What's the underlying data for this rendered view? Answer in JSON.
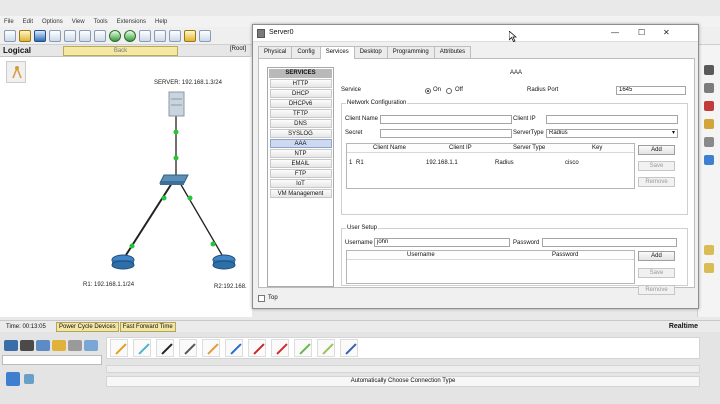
{
  "menu": [
    "File",
    "Edit",
    "Options",
    "View",
    "Tools",
    "Extensions",
    "Help"
  ],
  "logical": {
    "label": "Logical",
    "back_label": "Back",
    "root_label": "[Root]"
  },
  "topology": {
    "server_label": "SERVER: 192.168.1.3/24",
    "r1_label": "R1: 192.168.1.1/24",
    "r2_label": "R2:192.168."
  },
  "dialog": {
    "title": "Server0",
    "minimize": "—",
    "maximize": "☐",
    "close": "✕",
    "tabs": [
      "Physical",
      "Config",
      "Services",
      "Desktop",
      "Programming",
      "Attributes"
    ],
    "active_tab": "Services",
    "services_header": "SERVICES",
    "services": [
      "HTTP",
      "DHCP",
      "DHCPv6",
      "TFTP",
      "DNS",
      "SYSLOG",
      "AAA",
      "NTP",
      "EMAIL",
      "FTP",
      "IoT",
      "VM Management"
    ],
    "active_service": "AAA",
    "top_label": "Top"
  },
  "aaa": {
    "title": "AAA",
    "service_label": "Service",
    "on_label": "On",
    "off_label": "Off",
    "service_state": "On",
    "radius_port_label": "Radius Port",
    "radius_port_value": "1645",
    "network_config_title": "Network Configuration",
    "client_name_label": "Client Name",
    "client_name_value": "",
    "client_ip_label": "Client IP",
    "client_ip_value": "",
    "secret_label": "Secret",
    "secret_value": "",
    "server_type_label": "ServerType",
    "server_type_value": "Radius",
    "client_table": {
      "headers": [
        "Client Name",
        "Client IP",
        "Server Type",
        "Key"
      ],
      "rows": [
        {
          "index": "1",
          "name": "R1",
          "ip": "192.168.1.1",
          "type": "Radius",
          "key": "cisco"
        }
      ]
    },
    "add_label": "Add",
    "save_label": "Save",
    "remove_label": "Remove",
    "user_setup_title": "User Setup",
    "username_label": "Username",
    "username_value": "john",
    "password_label": "Password",
    "password_value": "",
    "user_table": {
      "headers": [
        "Username",
        "Password"
      ],
      "rows": []
    }
  },
  "status": {
    "time_label": "Time: 00:13:05",
    "power_cycle": "Power Cycle Devices",
    "fast_forward": "Fast Forward Time",
    "realtime": "Realtime"
  },
  "bottom": {
    "connection_type": "Automatically Choose Connection Type"
  },
  "colors": {
    "link_green": "#27c33a",
    "selection_blue": "#cdd9ef",
    "yellow_button": "#f1e6a3"
  }
}
